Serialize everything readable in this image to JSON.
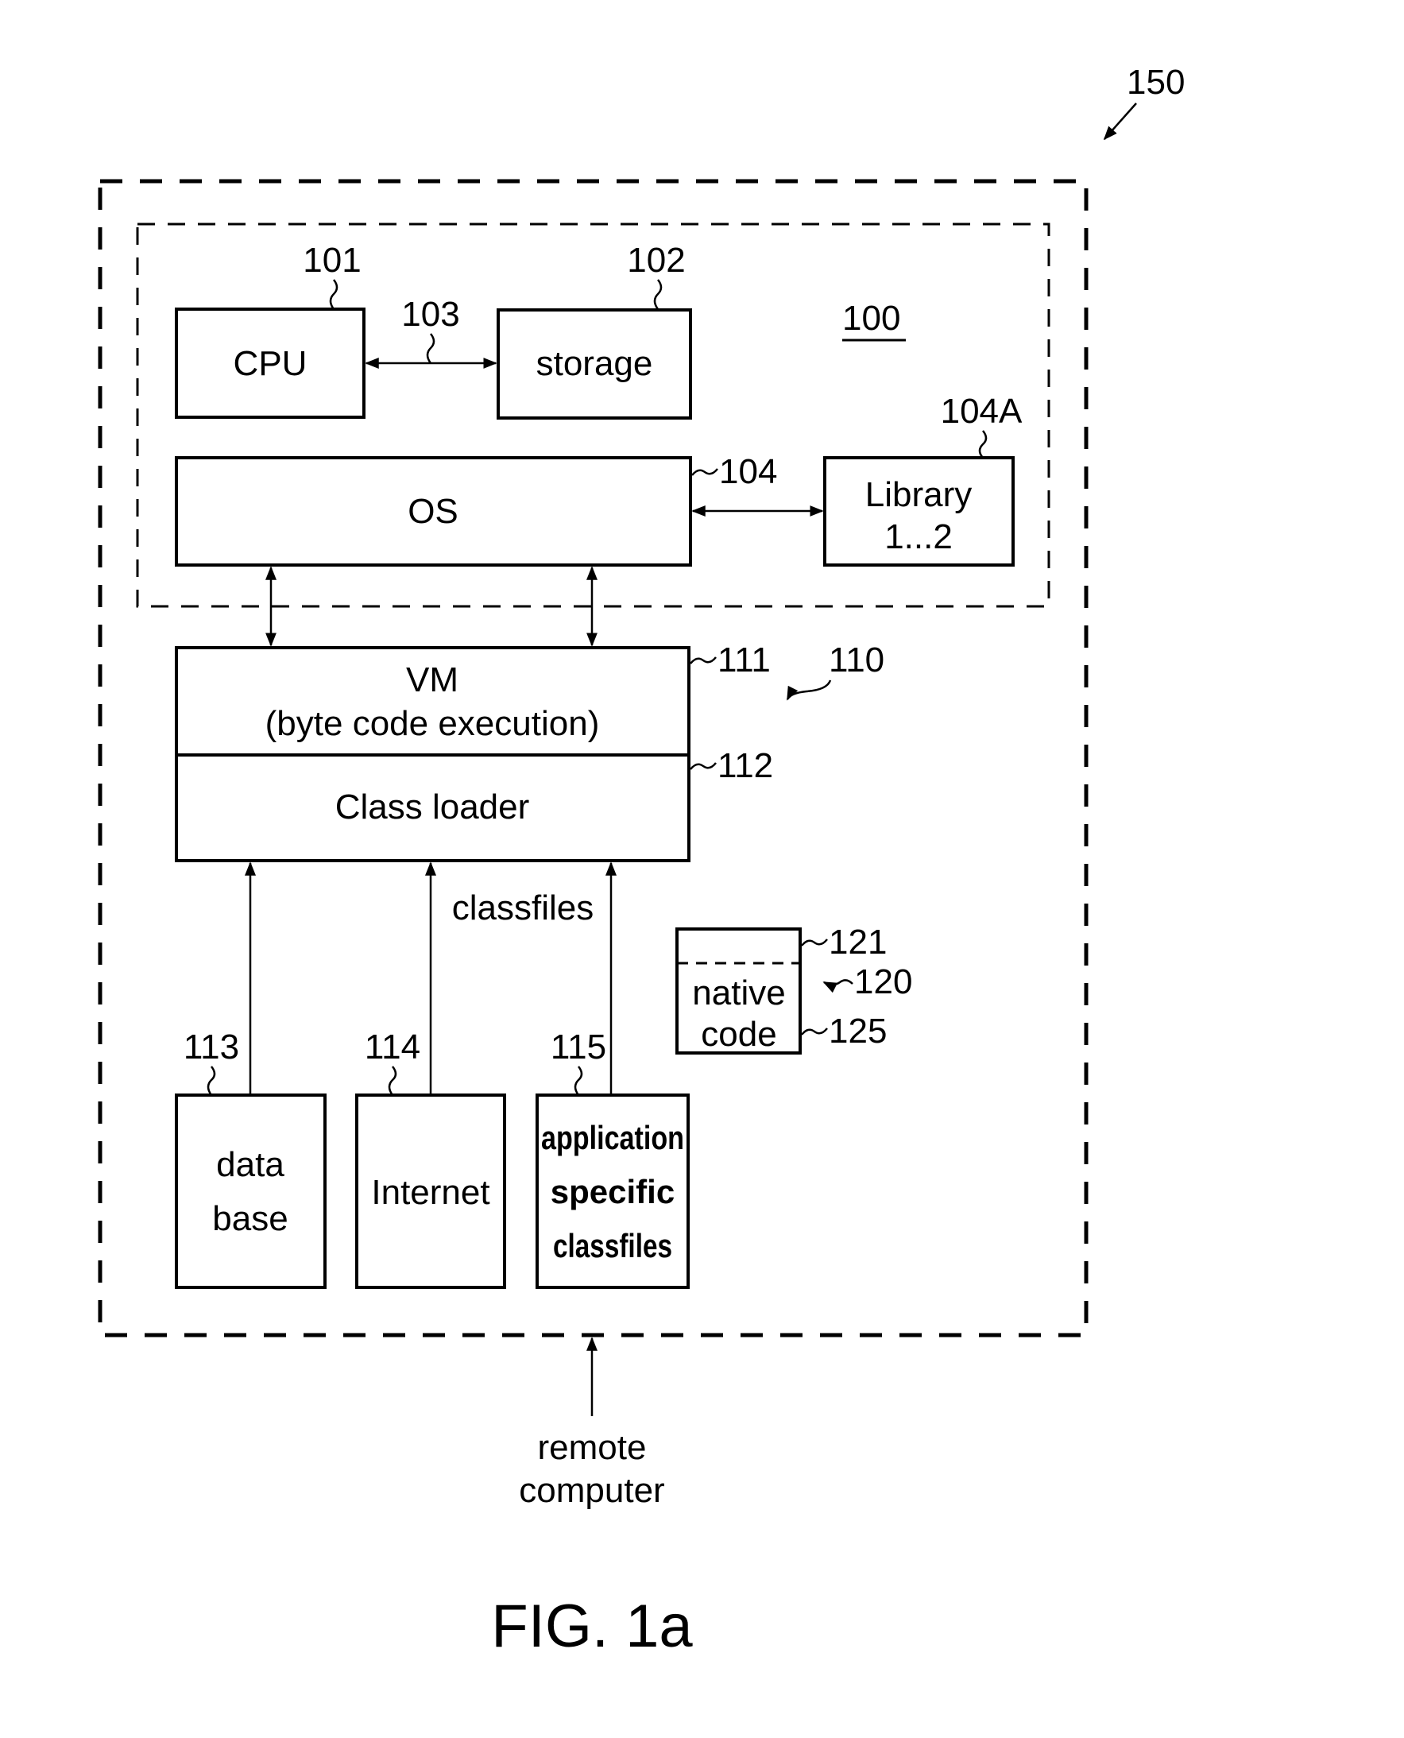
{
  "figure": {
    "caption": "FIG. 1a",
    "ref_system": "150",
    "ref_computer": "100",
    "ref_vm_group": "110"
  },
  "blocks": {
    "cpu": {
      "label": "CPU",
      "ref": "101"
    },
    "storage": {
      "label": "storage",
      "ref": "102"
    },
    "bus": {
      "ref": "103"
    },
    "os": {
      "label": "OS",
      "ref": "104"
    },
    "library": {
      "line1": "Library",
      "line2": "1...2",
      "ref": "104A"
    },
    "vm": {
      "line1": "VM",
      "line2": "(byte code execution)",
      "ref": "111"
    },
    "class_loader": {
      "label": "Class loader",
      "ref": "112"
    },
    "database": {
      "line1": "data",
      "line2": "base",
      "ref": "113"
    },
    "internet": {
      "label": "Internet",
      "ref": "114"
    },
    "app_classfiles": {
      "line1": "application",
      "line2": "specific",
      "line3": "classfiles",
      "ref": "115"
    },
    "native_code": {
      "line1": "native",
      "line2": "code",
      "ref_top": "121",
      "ref_group": "120",
      "ref_bottom": "125"
    }
  },
  "annotations": {
    "classfiles": "classfiles",
    "remote_line1": "remote",
    "remote_line2": "computer"
  }
}
